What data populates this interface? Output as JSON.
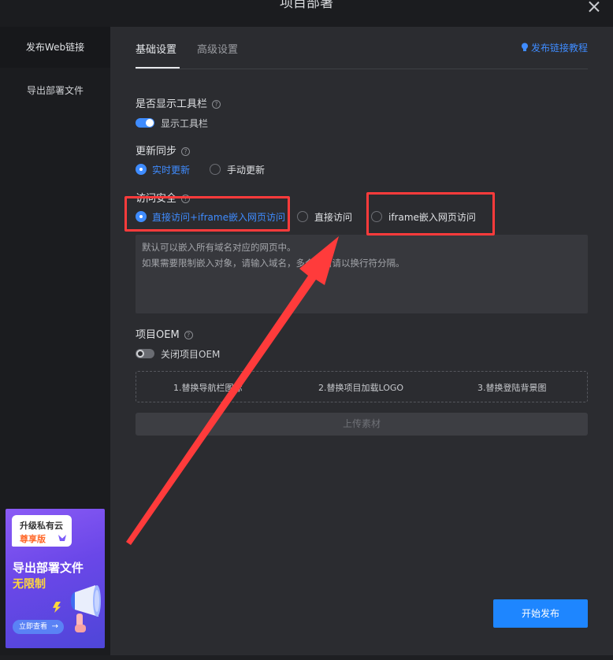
{
  "window": {
    "title": "项目部署"
  },
  "sidebar": {
    "items": [
      {
        "label": "发布Web链接",
        "active": true
      },
      {
        "label": "导出部署文件",
        "active": false
      }
    ],
    "promo": {
      "badge_line1": "升级私有云",
      "badge_line2": "尊享版",
      "headline": "导出部署文件",
      "subline": "无限制",
      "button": "立即查看"
    }
  },
  "tabs": [
    {
      "label": "基础设置",
      "active": true
    },
    {
      "label": "高级设置",
      "active": false
    }
  ],
  "tutorial_link": "发布链接教程",
  "toolbar_section": {
    "label": "是否显示工具栏",
    "toggle_label": "显示工具栏",
    "enabled": true
  },
  "sync_section": {
    "label": "更新同步",
    "options": [
      {
        "label": "实时更新",
        "checked": true
      },
      {
        "label": "手动更新",
        "checked": false
      }
    ]
  },
  "security_section": {
    "label": "访问安全",
    "options": [
      {
        "label": "直接访问+iframe嵌入网页访问",
        "checked": true
      },
      {
        "label": "直接访问",
        "checked": false
      },
      {
        "label": "iframe嵌入网页访问",
        "checked": false
      }
    ],
    "textarea_lines": [
      "默认可以嵌入所有域名对应的网页中。",
      "如果需要限制嵌入对象，请输入域名，多个域名请以换行符分隔。"
    ]
  },
  "oem_section": {
    "label": "项目OEM",
    "toggle_label": "关闭项目OEM",
    "enabled": false,
    "slots": [
      "1.替换导航栏图标",
      "2.替换项目加载LOGO",
      "3.替换登陆背景图"
    ],
    "upload_label": "上传素材"
  },
  "publish_button": "开始发布",
  "colors": {
    "accent": "#3f8cff",
    "highlight": "#ff3b3b"
  }
}
